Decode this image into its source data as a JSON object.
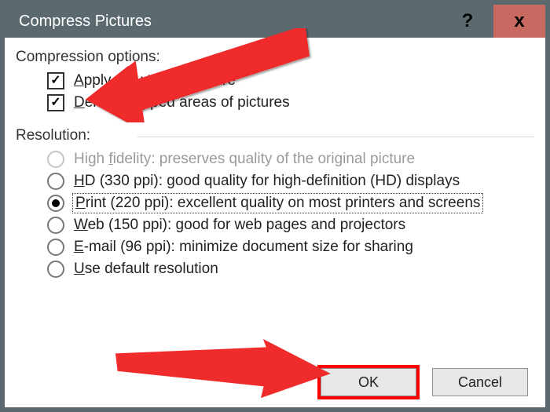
{
  "titlebar": {
    "title": "Compress Pictures",
    "help": "?",
    "close": "x"
  },
  "compression": {
    "group_label": "Compression options:",
    "apply_only": {
      "ak": "A",
      "rest": "pply only to this picture",
      "checked": true
    },
    "delete_cropped": {
      "ak": "D",
      "rest": "elete cropped areas of pictures",
      "checked": true
    }
  },
  "resolution": {
    "group_label": "Resolution:",
    "options": [
      {
        "pre": "High ",
        "ak": "f",
        "rest": "idelity: preserves quality of the original picture",
        "selected": false,
        "disabled": true
      },
      {
        "pre": "",
        "ak": "H",
        "rest": "D (330 ppi): good quality for high-definition (HD) displays",
        "selected": false,
        "disabled": false
      },
      {
        "pre": "",
        "ak": "P",
        "rest": "rint (220 ppi): excellent quality on most printers and screens",
        "selected": true,
        "disabled": false
      },
      {
        "pre": "",
        "ak": "W",
        "rest": "eb (150 ppi): good for web pages and projectors",
        "selected": false,
        "disabled": false
      },
      {
        "pre": "",
        "ak": "E",
        "rest": "-mail (96 ppi): minimize document size for sharing",
        "selected": false,
        "disabled": false
      },
      {
        "pre": "",
        "ak": "U",
        "rest": "se default resolution",
        "selected": false,
        "disabled": false
      }
    ]
  },
  "buttons": {
    "ok": "OK",
    "cancel": "Cancel"
  }
}
